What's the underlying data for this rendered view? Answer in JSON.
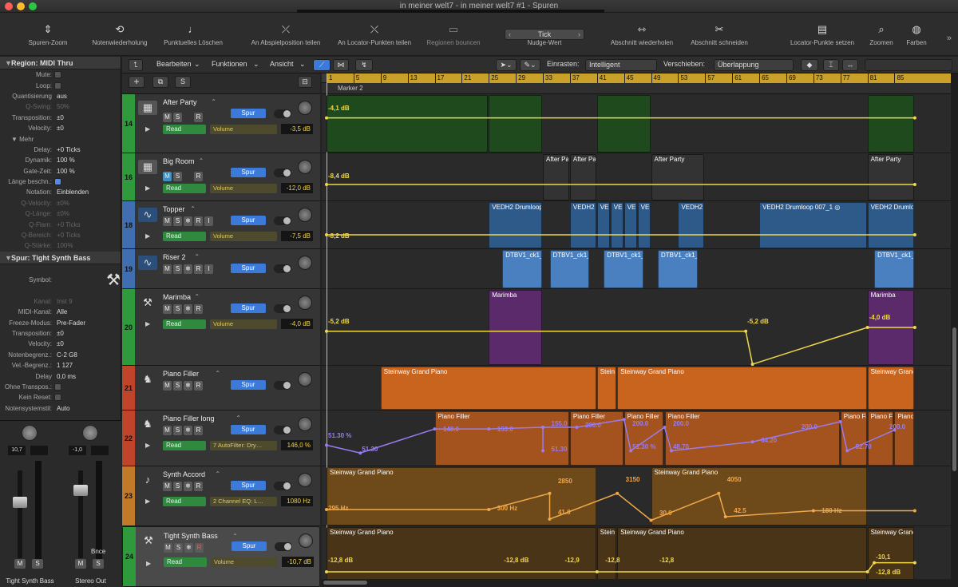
{
  "window": {
    "title": "in meiner welt7 - in meiner welt7 #1 - Spuren"
  },
  "toolbar": {
    "items": [
      {
        "label": "Spuren-Zoom",
        "icon": "track-zoom-icon"
      },
      {
        "label": "Notenwiederholung",
        "icon": "note-repeat-icon"
      },
      {
        "label": "Punktuelles Löschen",
        "icon": "erase-note-icon"
      },
      {
        "label": "An Abspielposition teilen",
        "icon": "split-playhead-icon"
      },
      {
        "label": "An Locator-Punkten teilen",
        "icon": "split-locators-icon"
      },
      {
        "label": "Regionen bouncen",
        "icon": "bounce-regions-icon"
      },
      {
        "label": "Nudge-Wert",
        "icon": "nudge-icon"
      },
      {
        "label": "Abschnitt wiederholen",
        "icon": "repeat-section-icon"
      },
      {
        "label": "Abschnitt schneiden",
        "icon": "cut-section-icon"
      },
      {
        "label": "Locator-Punkte setzen",
        "icon": "set-locators-icon"
      },
      {
        "label": "Zoomen",
        "icon": "zoom-icon"
      },
      {
        "label": "Farben",
        "icon": "colors-icon"
      }
    ],
    "nudge_value": "Tick"
  },
  "inspector": {
    "region_header": "Region:  MIDI Thru",
    "region_rows": [
      {
        "label": "Mute:",
        "value": "",
        "type": "check"
      },
      {
        "label": "Loop:",
        "value": "",
        "type": "check"
      },
      {
        "label": "Quantisierung",
        "value": "aus"
      },
      {
        "label": "Q-Swing:",
        "value": "50%",
        "dim": true
      },
      {
        "label": "Transposition:",
        "value": "±0"
      },
      {
        "label": "Velocity:",
        "value": "±0"
      },
      {
        "label": "Mehr",
        "value": "",
        "type": "sub"
      },
      {
        "label": "Delay:",
        "value": "+0 Ticks"
      },
      {
        "label": "Dynamik:",
        "value": "100 %"
      },
      {
        "label": "Gate-Zeit:",
        "value": "100 %"
      },
      {
        "label": "Länge beschn.:",
        "value": "",
        "type": "checkon"
      },
      {
        "label": "Notation:",
        "value": "Einblenden"
      },
      {
        "label": "Q-Velocity:",
        "value": "±0%",
        "dim": true
      },
      {
        "label": "Q-Länge:",
        "value": "±0%",
        "dim": true
      },
      {
        "label": "Q-Flam:",
        "value": "+0 Ticks",
        "dim": true
      },
      {
        "label": "Q-Bereich:",
        "value": "+0 Ticks",
        "dim": true
      },
      {
        "label": "Q-Stärke:",
        "value": "100%",
        "dim": true
      }
    ],
    "track_header": "Spur:  Tight Synth Bass",
    "track_rows": [
      {
        "label": "Symbol:",
        "value": "",
        "type": "symbol"
      },
      {
        "label": "Kanal:",
        "value": "Inst 9",
        "dim": true
      },
      {
        "label": "MIDI-Kanal:",
        "value": "Alle"
      },
      {
        "label": "Freeze-Modus:",
        "value": "Pre-Fader"
      },
      {
        "label": "Transposition:",
        "value": "±0"
      },
      {
        "label": "Velocity:",
        "value": "±0"
      },
      {
        "label": "Notenbegrenz.:",
        "value": "C-2    G8"
      },
      {
        "label": "Vel.-Begrenz.:",
        "value": "1    127"
      },
      {
        "label": "Delay",
        "value": "0,0 ms"
      },
      {
        "label": "Ohne Transpos.:",
        "value": "",
        "type": "check"
      },
      {
        "label": "Kein Reset:",
        "value": "",
        "type": "check"
      },
      {
        "label": "Notensystemstil:",
        "value": "Auto"
      }
    ],
    "strips": [
      {
        "name": "Tight Synth Bass",
        "value": "10,7",
        "m": "M",
        "s": "S",
        "extra": ""
      },
      {
        "name": "Stereo Out",
        "value": "-1,0",
        "m": "M",
        "s": "S",
        "extra": "Bnce"
      }
    ]
  },
  "tracks_bar": {
    "menus": [
      "Bearbeiten",
      "Funktionen",
      "Ansicht"
    ],
    "snap_label": "Einrasten:",
    "snap_value": "Intelligent",
    "drag_label": "Verschieben:",
    "drag_value": "Überlappung"
  },
  "header_top": {
    "add": "+",
    "s": "S"
  },
  "tracks": [
    {
      "num": "14",
      "name": "After Party",
      "color": "#2e9a3c",
      "icon": "drum-machine-icon",
      "glyph": "▦",
      "h": 74,
      "freeze": false,
      "i": false,
      "mode": "Read",
      "param": "Volume",
      "val": "-3,5 dB",
      "mblue": false,
      "rred": false
    },
    {
      "num": "16",
      "name": "Big Room",
      "color": "#2e9a3c",
      "icon": "drum-machine-icon",
      "glyph": "▦",
      "h": 60,
      "freeze": false,
      "i": false,
      "mode": "Read",
      "param": "Volume",
      "val": "-12,0 dB",
      "mblue": true,
      "rred": false
    },
    {
      "num": "18",
      "name": "Topper",
      "color": "#3f6fb0",
      "icon": "audio-waveform-icon",
      "glyph": "∿",
      "h": 60,
      "freeze": true,
      "i": true,
      "mode": "Read",
      "param": "Volume",
      "val": "-7,5 dB",
      "mblue": false,
      "rred": false
    },
    {
      "num": "19",
      "name": "Riser 2",
      "color": "#3f6fb0",
      "icon": "audio-waveform-icon",
      "glyph": "∿",
      "h": 50,
      "freeze": true,
      "i": true,
      "mode": "",
      "param": "",
      "val": "",
      "mblue": false,
      "rred": false
    },
    {
      "num": "20",
      "name": "Marimba",
      "color": "#2e9a3c",
      "icon": "keyboard-stand-icon",
      "glyph": "⚒",
      "h": 96,
      "freeze": true,
      "i": false,
      "mode": "Read",
      "param": "Volume",
      "val": "-4,0 dB",
      "mblue": false,
      "rred": false
    },
    {
      "num": "21",
      "name": "Piano Filler",
      "color": "#c0442a",
      "icon": "grand-piano-icon",
      "glyph": "♞",
      "h": 56,
      "freeze": true,
      "i": false,
      "mode": "",
      "param": "",
      "val": "",
      "mblue": false,
      "rred": false
    },
    {
      "num": "22",
      "name": "Piano Filler long",
      "color": "#c0442a",
      "icon": "grand-piano-icon",
      "glyph": "♞",
      "h": 70,
      "freeze": true,
      "i": false,
      "mode": "Read",
      "param": "7 AutoFilter: Dry…",
      "val": "146,0 %",
      "mblue": false,
      "rred": false
    },
    {
      "num": "23",
      "name": "Synth Accord",
      "color": "#c07a2a",
      "icon": "violin-icon",
      "glyph": "♪",
      "h": 75,
      "freeze": true,
      "i": false,
      "mode": "Read",
      "param": "2 Channel EQ: L…",
      "val": "1080 Hz",
      "mblue": false,
      "rred": false
    },
    {
      "num": "24",
      "name": "Tight Synth Bass",
      "color": "#2e9a3c",
      "icon": "keyboard-stand-icon",
      "glyph": "⚒",
      "h": 76,
      "freeze": true,
      "i": false,
      "mode": "Read",
      "param": "Volume",
      "val": "-10,7 dB",
      "mblue": false,
      "rred": true,
      "selected": true
    }
  ],
  "ruler": {
    "bars": [
      "1",
      "5",
      "9",
      "13",
      "17",
      "21",
      "25",
      "29",
      "33",
      "37",
      "41",
      "45",
      "49",
      "53",
      "57",
      "61",
      "65",
      "69",
      "73",
      "77",
      "81",
      "85"
    ],
    "marker": "Marker 2"
  },
  "regions": [
    {
      "lane": 0,
      "bars": [
        1,
        25
      ],
      "name": "",
      "color": "#1e4a1e"
    },
    {
      "lane": 0,
      "bars": [
        25,
        33
      ],
      "name": "",
      "color": "#1e4a1e"
    },
    {
      "lane": 0,
      "bars": [
        41,
        49
      ],
      "name": "",
      "color": "#1e4a1e"
    },
    {
      "lane": 0,
      "bars": [
        81,
        88
      ],
      "name": "",
      "color": "#1e4a1e"
    },
    {
      "lane": 1,
      "bars": [
        33,
        37
      ],
      "name": "After Party",
      "color": "#333"
    },
    {
      "lane": 1,
      "bars": [
        37,
        41
      ],
      "name": "After Pa",
      "color": "#333"
    },
    {
      "lane": 1,
      "bars": [
        49,
        57
      ],
      "name": "After Party",
      "color": "#333"
    },
    {
      "lane": 1,
      "bars": [
        81,
        88
      ],
      "name": "After Party",
      "color": "#333"
    },
    {
      "lane": 2,
      "bars": [
        25,
        33
      ],
      "name": "VEDH2 Drumloop",
      "color": "#2e5a8a"
    },
    {
      "lane": 2,
      "bars": [
        37,
        41
      ],
      "name": "VEDH2",
      "color": "#2e5a8a"
    },
    {
      "lane": 2,
      "bars": [
        41,
        43
      ],
      "name": "VE",
      "color": "#2e5a8a"
    },
    {
      "lane": 2,
      "bars": [
        43,
        45
      ],
      "name": "VE",
      "color": "#2e5a8a"
    },
    {
      "lane": 2,
      "bars": [
        45,
        47
      ],
      "name": "VE",
      "color": "#2e5a8a"
    },
    {
      "lane": 2,
      "bars": [
        47,
        49
      ],
      "name": "VE",
      "color": "#2e5a8a"
    },
    {
      "lane": 2,
      "bars": [
        53,
        57
      ],
      "name": "VEDH2",
      "color": "#2e5a8a"
    },
    {
      "lane": 2,
      "bars": [
        65,
        81
      ],
      "name": "VEDH2 Drumloop 007_1 ◎",
      "color": "#2e5a8a"
    },
    {
      "lane": 2,
      "bars": [
        81,
        88
      ],
      "name": "VEDH2 Drumloop",
      "color": "#2e5a8a"
    },
    {
      "lane": 3,
      "bars": [
        27,
        33
      ],
      "name": "DTBV1_ck1_E",
      "color": "#4a80c0"
    },
    {
      "lane": 3,
      "bars": [
        34,
        40
      ],
      "name": "DTBV1_ck1_E",
      "color": "#4a80c0"
    },
    {
      "lane": 3,
      "bars": [
        42,
        48
      ],
      "name": "DTBV1_ck1_E",
      "color": "#4a80c0"
    },
    {
      "lane": 3,
      "bars": [
        50,
        56
      ],
      "name": "DTBV1_ck1_E",
      "color": "#4a80c0"
    },
    {
      "lane": 3,
      "bars": [
        82,
        88
      ],
      "name": "DTBV1_ck1_E",
      "color": "#4a80c0"
    },
    {
      "lane": 4,
      "bars": [
        25,
        33
      ],
      "name": "Marimba",
      "color": "#5a2a6a"
    },
    {
      "lane": 4,
      "bars": [
        81,
        88
      ],
      "name": "Marimba",
      "color": "#5a2a6a"
    },
    {
      "lane": 5,
      "bars": [
        9,
        41
      ],
      "name": "Steinway Grand Piano",
      "color": "#c8641e"
    },
    {
      "lane": 5,
      "bars": [
        41,
        44
      ],
      "name": "Stein",
      "color": "#c8641e"
    },
    {
      "lane": 5,
      "bars": [
        44,
        81
      ],
      "name": "Steinway Grand Piano",
      "color": "#c8641e"
    },
    {
      "lane": 5,
      "bars": [
        81,
        88
      ],
      "name": "Steinway Grand Piano",
      "color": "#c8641e"
    },
    {
      "lane": 6,
      "bars": [
        17,
        37
      ],
      "name": "Piano Filler",
      "color": "#a4521e"
    },
    {
      "lane": 6,
      "bars": [
        37,
        45
      ],
      "name": "Piano Filler",
      "color": "#a4521e"
    },
    {
      "lane": 6,
      "bars": [
        45,
        51
      ],
      "name": "Piano Filler",
      "color": "#a4521e"
    },
    {
      "lane": 6,
      "bars": [
        51,
        77
      ],
      "name": "Piano Filler",
      "color": "#a4521e"
    },
    {
      "lane": 6,
      "bars": [
        77,
        81
      ],
      "name": "Piano Fi",
      "color": "#a4521e"
    },
    {
      "lane": 6,
      "bars": [
        81,
        85
      ],
      "name": "Piano Fi",
      "color": "#a4521e"
    },
    {
      "lane": 6,
      "bars": [
        85,
        88
      ],
      "name": "Piano Fill",
      "color": "#a4521e"
    },
    {
      "lane": 7,
      "bars": [
        1,
        41
      ],
      "name": "Steinway Grand Piano",
      "color": "#6e4a1a"
    },
    {
      "lane": 7,
      "bars": [
        49,
        81
      ],
      "name": "Steinway Grand Piano",
      "color": "#6e4a1a"
    },
    {
      "lane": 8,
      "bars": [
        1,
        41
      ],
      "name": "Steinway Grand Piano",
      "color": "#4a3418"
    },
    {
      "lane": 8,
      "bars": [
        41,
        44
      ],
      "name": "Stein",
      "color": "#4a3418"
    },
    {
      "lane": 8,
      "bars": [
        44,
        81
      ],
      "name": "Steinway Grand Piano",
      "color": "#4a3418"
    },
    {
      "lane": 8,
      "bars": [
        81,
        88
      ],
      "name": "Steinway Grand Piano",
      "color": "#4a3418"
    }
  ],
  "automation": [
    {
      "lane": 0,
      "color": "#f0d84a",
      "points": [
        [
          1,
          0.4
        ],
        [
          88,
          0.4
        ]
      ],
      "labels": [
        {
          "bar": 1,
          "y": 0.3,
          "text": "-4,1 dB"
        }
      ]
    },
    {
      "lane": 1,
      "color": "#f0d84a",
      "points": [
        [
          1,
          0.65
        ],
        [
          88,
          0.65
        ]
      ],
      "labels": [
        {
          "bar": 1,
          "y": 0.55,
          "text": "-8,4 dB"
        }
      ]
    },
    {
      "lane": 2,
      "color": "#f0d84a",
      "points": [
        [
          1,
          0.7
        ],
        [
          88,
          0.7
        ]
      ],
      "labels": [
        {
          "bar": 1,
          "y": 0.8,
          "text": "-8,2 dB"
        }
      ]
    },
    {
      "lane": 4,
      "color": "#f0d84a",
      "points": [
        [
          1,
          0.55
        ],
        [
          63,
          0.55
        ],
        [
          64,
          0.98
        ],
        [
          81,
          0.5
        ],
        [
          88,
          0.5
        ]
      ],
      "labels": [
        {
          "bar": 1,
          "y": 0.47,
          "text": "-5,2 dB"
        },
        {
          "bar": 63,
          "y": 0.47,
          "text": "-5,2 dB"
        },
        {
          "bar": 81,
          "y": 0.42,
          "text": "-4,0 dB"
        }
      ]
    },
    {
      "lane": 6,
      "color": "#9a7cf0",
      "points": [
        [
          1,
          0.62
        ],
        [
          6,
          0.76
        ],
        [
          17,
          0.33
        ],
        [
          25,
          0.33
        ],
        [
          33,
          0.3
        ],
        [
          33,
          0.72
        ],
        [
          33,
          0.3
        ],
        [
          38,
          0.3
        ],
        [
          45,
          0.16
        ],
        [
          46,
          0.72
        ],
        [
          51,
          0.3
        ],
        [
          52,
          0.72
        ],
        [
          64,
          0.56
        ],
        [
          77,
          0.2
        ],
        [
          78,
          0.72
        ],
        [
          85,
          0.35
        ]
      ],
      "labels": [
        {
          "bar": 1,
          "y": 0.52,
          "text": "51.30 %"
        },
        {
          "bar": 6,
          "y": 0.76,
          "text": "51.30"
        },
        {
          "bar": 18,
          "y": 0.4,
          "text": "148.0"
        },
        {
          "bar": 26,
          "y": 0.4,
          "text": "153.0"
        },
        {
          "bar": 34,
          "y": 0.3,
          "text": "155.0"
        },
        {
          "bar": 34,
          "y": 0.76,
          "text": "51.30"
        },
        {
          "bar": 39,
          "y": 0.33,
          "text": "200.0"
        },
        {
          "bar": 46,
          "y": 0.72,
          "text": "51.30 %"
        },
        {
          "bar": 46,
          "y": 0.3,
          "text": "200.0"
        },
        {
          "bar": 52,
          "y": 0.3,
          "text": "200.0"
        },
        {
          "bar": 52,
          "y": 0.72,
          "text": "48.70"
        },
        {
          "bar": 65,
          "y": 0.6,
          "text": "64.20"
        },
        {
          "bar": 71,
          "y": 0.36,
          "text": "200.0"
        },
        {
          "bar": 79,
          "y": 0.72,
          "text": "52.70"
        },
        {
          "bar": 84,
          "y": 0.36,
          "text": "200.0"
        }
      ]
    },
    {
      "lane": 7,
      "color": "#f0a84a",
      "points": [
        [
          1,
          0.72
        ],
        [
          25,
          0.72
        ],
        [
          34,
          0.45
        ],
        [
          34,
          0.88
        ],
        [
          44,
          0.45
        ],
        [
          49,
          0.9
        ],
        [
          59,
          0.45
        ],
        [
          60,
          0.84
        ],
        [
          73,
          0.74
        ],
        [
          88,
          0.74
        ]
      ],
      "labels": [
        {
          "bar": 1,
          "y": 0.76,
          "text": "295 Hz"
        },
        {
          "bar": 26,
          "y": 0.76,
          "text": "300 Hz"
        },
        {
          "bar": 35,
          "y": 0.3,
          "text": "2850"
        },
        {
          "bar": 35,
          "y": 0.82,
          "text": "41.0"
        },
        {
          "bar": 45,
          "y": 0.28,
          "text": "3150"
        },
        {
          "bar": 50,
          "y": 0.84,
          "text": "30.0"
        },
        {
          "bar": 60,
          "y": 0.28,
          "text": "4050"
        },
        {
          "bar": 61,
          "y": 0.8,
          "text": "42.5"
        },
        {
          "bar": 74,
          "y": 0.8,
          "text": "180 Hz"
        }
      ]
    },
    {
      "lane": 8,
      "color": "#f0d84a",
      "points": [
        [
          1,
          0.75
        ],
        [
          41,
          0.75
        ],
        [
          81,
          0.75
        ],
        [
          82,
          0.6
        ],
        [
          88,
          0.6
        ]
      ],
      "labels": [
        {
          "bar": 1,
          "y": 0.62,
          "text": "-12,8 dB"
        },
        {
          "bar": 27,
          "y": 0.62,
          "text": "-12,8 dB"
        },
        {
          "bar": 36,
          "y": 0.62,
          "text": "-12,9"
        },
        {
          "bar": 42,
          "y": 0.62,
          "text": "-12,8"
        },
        {
          "bar": 50,
          "y": 0.62,
          "text": "-12,8"
        },
        {
          "bar": 82,
          "y": 0.56,
          "text": "-10,1"
        },
        {
          "bar": 82,
          "y": 0.82,
          "text": "-12,8 dB"
        }
      ]
    }
  ]
}
